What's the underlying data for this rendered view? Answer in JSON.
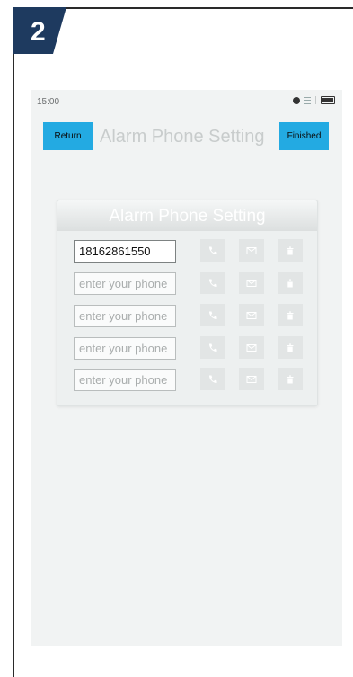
{
  "step": {
    "number": "2"
  },
  "status_bar": {
    "time": "15:00"
  },
  "header": {
    "return_label": "Return",
    "title": "Alarm Phone Setting",
    "finished_label": "Finished"
  },
  "panel": {
    "title": "Alarm Phone Setting",
    "rows": [
      {
        "value": "18162861550"
      },
      {
        "placeholder": "enter your phone"
      },
      {
        "placeholder": "enter your phone"
      },
      {
        "placeholder": "enter your phone"
      },
      {
        "placeholder": "enter your phone"
      }
    ]
  },
  "colors": {
    "accent": "#23aae2",
    "badge": "#1e3a5f"
  }
}
